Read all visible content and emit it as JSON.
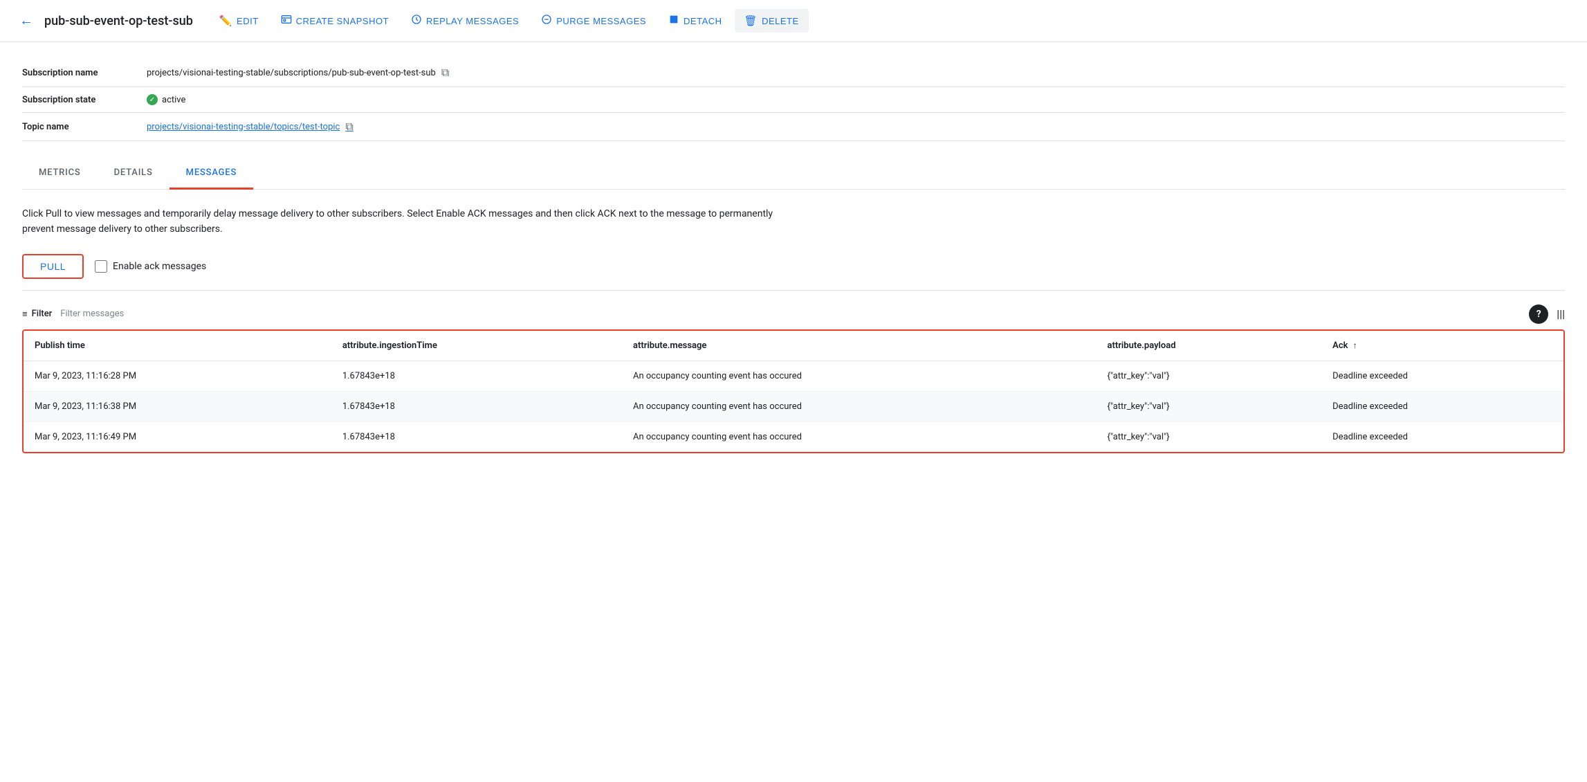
{
  "toolbar": {
    "back_icon": "←",
    "title": "pub-sub-event-op-test-sub",
    "actions": [
      {
        "id": "edit",
        "label": "EDIT",
        "icon": "✏️"
      },
      {
        "id": "create-snapshot",
        "label": "CREATE SNAPSHOT",
        "icon": "📷"
      },
      {
        "id": "replay-messages",
        "label": "REPLAY MESSAGES",
        "icon": "⏱"
      },
      {
        "id": "purge-messages",
        "label": "PURGE MESSAGES",
        "icon": "⊖"
      },
      {
        "id": "detach",
        "label": "DETACH",
        "icon": "⏹"
      },
      {
        "id": "delete",
        "label": "DELETE",
        "icon": "🗑"
      }
    ]
  },
  "details": {
    "rows": [
      {
        "label": "Subscription name",
        "value": "projects/visionai-testing-stable/subscriptions/pub-sub-event-op-test-sub",
        "type": "text-copy"
      },
      {
        "label": "Subscription state",
        "value": "active",
        "type": "status"
      },
      {
        "label": "Topic name",
        "value": "projects/visionai-testing-stable/topics/test-topic",
        "type": "link-copy"
      }
    ]
  },
  "tabs": [
    {
      "id": "metrics",
      "label": "METRICS",
      "active": false
    },
    {
      "id": "details",
      "label": "DETAILS",
      "active": false
    },
    {
      "id": "messages",
      "label": "MESSAGES",
      "active": true
    }
  ],
  "messages": {
    "info_text": "Click Pull to view messages and temporarily delay message delivery to other subscribers. Select Enable ACK messages and then click ACK next to the message to permanently prevent message delivery to other subscribers.",
    "pull_label": "PULL",
    "enable_ack_label": "Enable ack messages",
    "filter": {
      "icon": "≡",
      "label": "Filter",
      "placeholder": "Filter messages"
    },
    "table": {
      "columns": [
        {
          "id": "publish-time",
          "label": "Publish time",
          "sortable": false
        },
        {
          "id": "ingestion-time",
          "label": "attribute.ingestionTime",
          "sortable": false
        },
        {
          "id": "message",
          "label": "attribute.message",
          "sortable": false
        },
        {
          "id": "payload",
          "label": "attribute.payload",
          "sortable": false
        },
        {
          "id": "ack",
          "label": "Ack",
          "sortable": true
        }
      ],
      "rows": [
        {
          "publish_time": "Mar 9, 2023, 11:16:28 PM",
          "ingestion_time": "1.67843e+18",
          "message": "An occupancy counting event has occured",
          "payload": "{\"attr_key\":\"val\"}",
          "ack": "Deadline exceeded"
        },
        {
          "publish_time": "Mar 9, 2023, 11:16:38 PM",
          "ingestion_time": "1.67843e+18",
          "message": "An occupancy counting event has occured",
          "payload": "{\"attr_key\":\"val\"}",
          "ack": "Deadline exceeded"
        },
        {
          "publish_time": "Mar 9, 2023, 11:16:49 PM",
          "ingestion_time": "1.67843e+18",
          "message": "An occupancy counting event has occured",
          "payload": "{\"attr_key\":\"val\"}",
          "ack": "Deadline exceeded"
        }
      ]
    }
  }
}
